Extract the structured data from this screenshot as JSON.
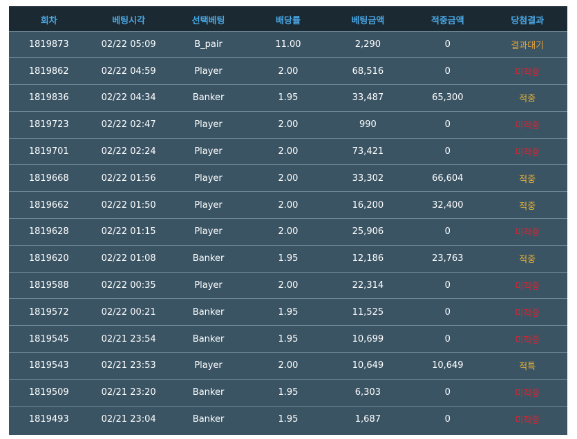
{
  "columns": [
    "회차",
    "베팅시각",
    "선택베팅",
    "배당률",
    "베팅금액",
    "적중금액",
    "당첨결과"
  ],
  "rows": [
    {
      "round": "1819873",
      "time": "02/22 05:09",
      "pick": "B_pair",
      "odds": "11.00",
      "bet": "2,290",
      "win": "0",
      "result": "결과대기",
      "status": "wait"
    },
    {
      "round": "1819862",
      "time": "02/22 04:59",
      "pick": "Player",
      "odds": "2.00",
      "bet": "68,516",
      "win": "0",
      "result": "미적중",
      "status": "miss"
    },
    {
      "round": "1819836",
      "time": "02/22 04:34",
      "pick": "Banker",
      "odds": "1.95",
      "bet": "33,487",
      "win": "65,300",
      "result": "적중",
      "status": "hit"
    },
    {
      "round": "1819723",
      "time": "02/22 02:47",
      "pick": "Player",
      "odds": "2.00",
      "bet": "990",
      "win": "0",
      "result": "미적중",
      "status": "miss"
    },
    {
      "round": "1819701",
      "time": "02/22 02:24",
      "pick": "Player",
      "odds": "2.00",
      "bet": "73,421",
      "win": "0",
      "result": "미적중",
      "status": "miss"
    },
    {
      "round": "1819668",
      "time": "02/22 01:56",
      "pick": "Player",
      "odds": "2.00",
      "bet": "33,302",
      "win": "66,604",
      "result": "적중",
      "status": "hit"
    },
    {
      "round": "1819662",
      "time": "02/22 01:50",
      "pick": "Player",
      "odds": "2.00",
      "bet": "16,200",
      "win": "32,400",
      "result": "적중",
      "status": "hit"
    },
    {
      "round": "1819628",
      "time": "02/22 01:15",
      "pick": "Player",
      "odds": "2.00",
      "bet": "25,906",
      "win": "0",
      "result": "미적중",
      "status": "miss"
    },
    {
      "round": "1819620",
      "time": "02/22 01:08",
      "pick": "Banker",
      "odds": "1.95",
      "bet": "12,186",
      "win": "23,763",
      "result": "적중",
      "status": "hit"
    },
    {
      "round": "1819588",
      "time": "02/22 00:35",
      "pick": "Player",
      "odds": "2.00",
      "bet": "22,314",
      "win": "0",
      "result": "미적중",
      "status": "miss"
    },
    {
      "round": "1819572",
      "time": "02/22 00:21",
      "pick": "Banker",
      "odds": "1.95",
      "bet": "11,525",
      "win": "0",
      "result": "미적중",
      "status": "miss"
    },
    {
      "round": "1819545",
      "time": "02/21 23:54",
      "pick": "Banker",
      "odds": "1.95",
      "bet": "10,699",
      "win": "0",
      "result": "미적중",
      "status": "miss"
    },
    {
      "round": "1819543",
      "time": "02/21 23:53",
      "pick": "Player",
      "odds": "2.00",
      "bet": "10,649",
      "win": "10,649",
      "result": "적특",
      "status": "special"
    },
    {
      "round": "1819509",
      "time": "02/21 23:20",
      "pick": "Banker",
      "odds": "1.95",
      "bet": "6,303",
      "win": "0",
      "result": "미적중",
      "status": "miss"
    },
    {
      "round": "1819493",
      "time": "02/21 23:04",
      "pick": "Banker",
      "odds": "1.95",
      "bet": "1,687",
      "win": "0",
      "result": "미적중",
      "status": "miss"
    }
  ],
  "colors": {
    "header_bg": "#1b2932",
    "header_text": "#4aa8e6",
    "row_bg": "#3a5464",
    "row_divider": "#6f8896",
    "result_wait": "#e3a23d",
    "result_hit": "#e8b033",
    "result_miss": "#d8242f"
  }
}
